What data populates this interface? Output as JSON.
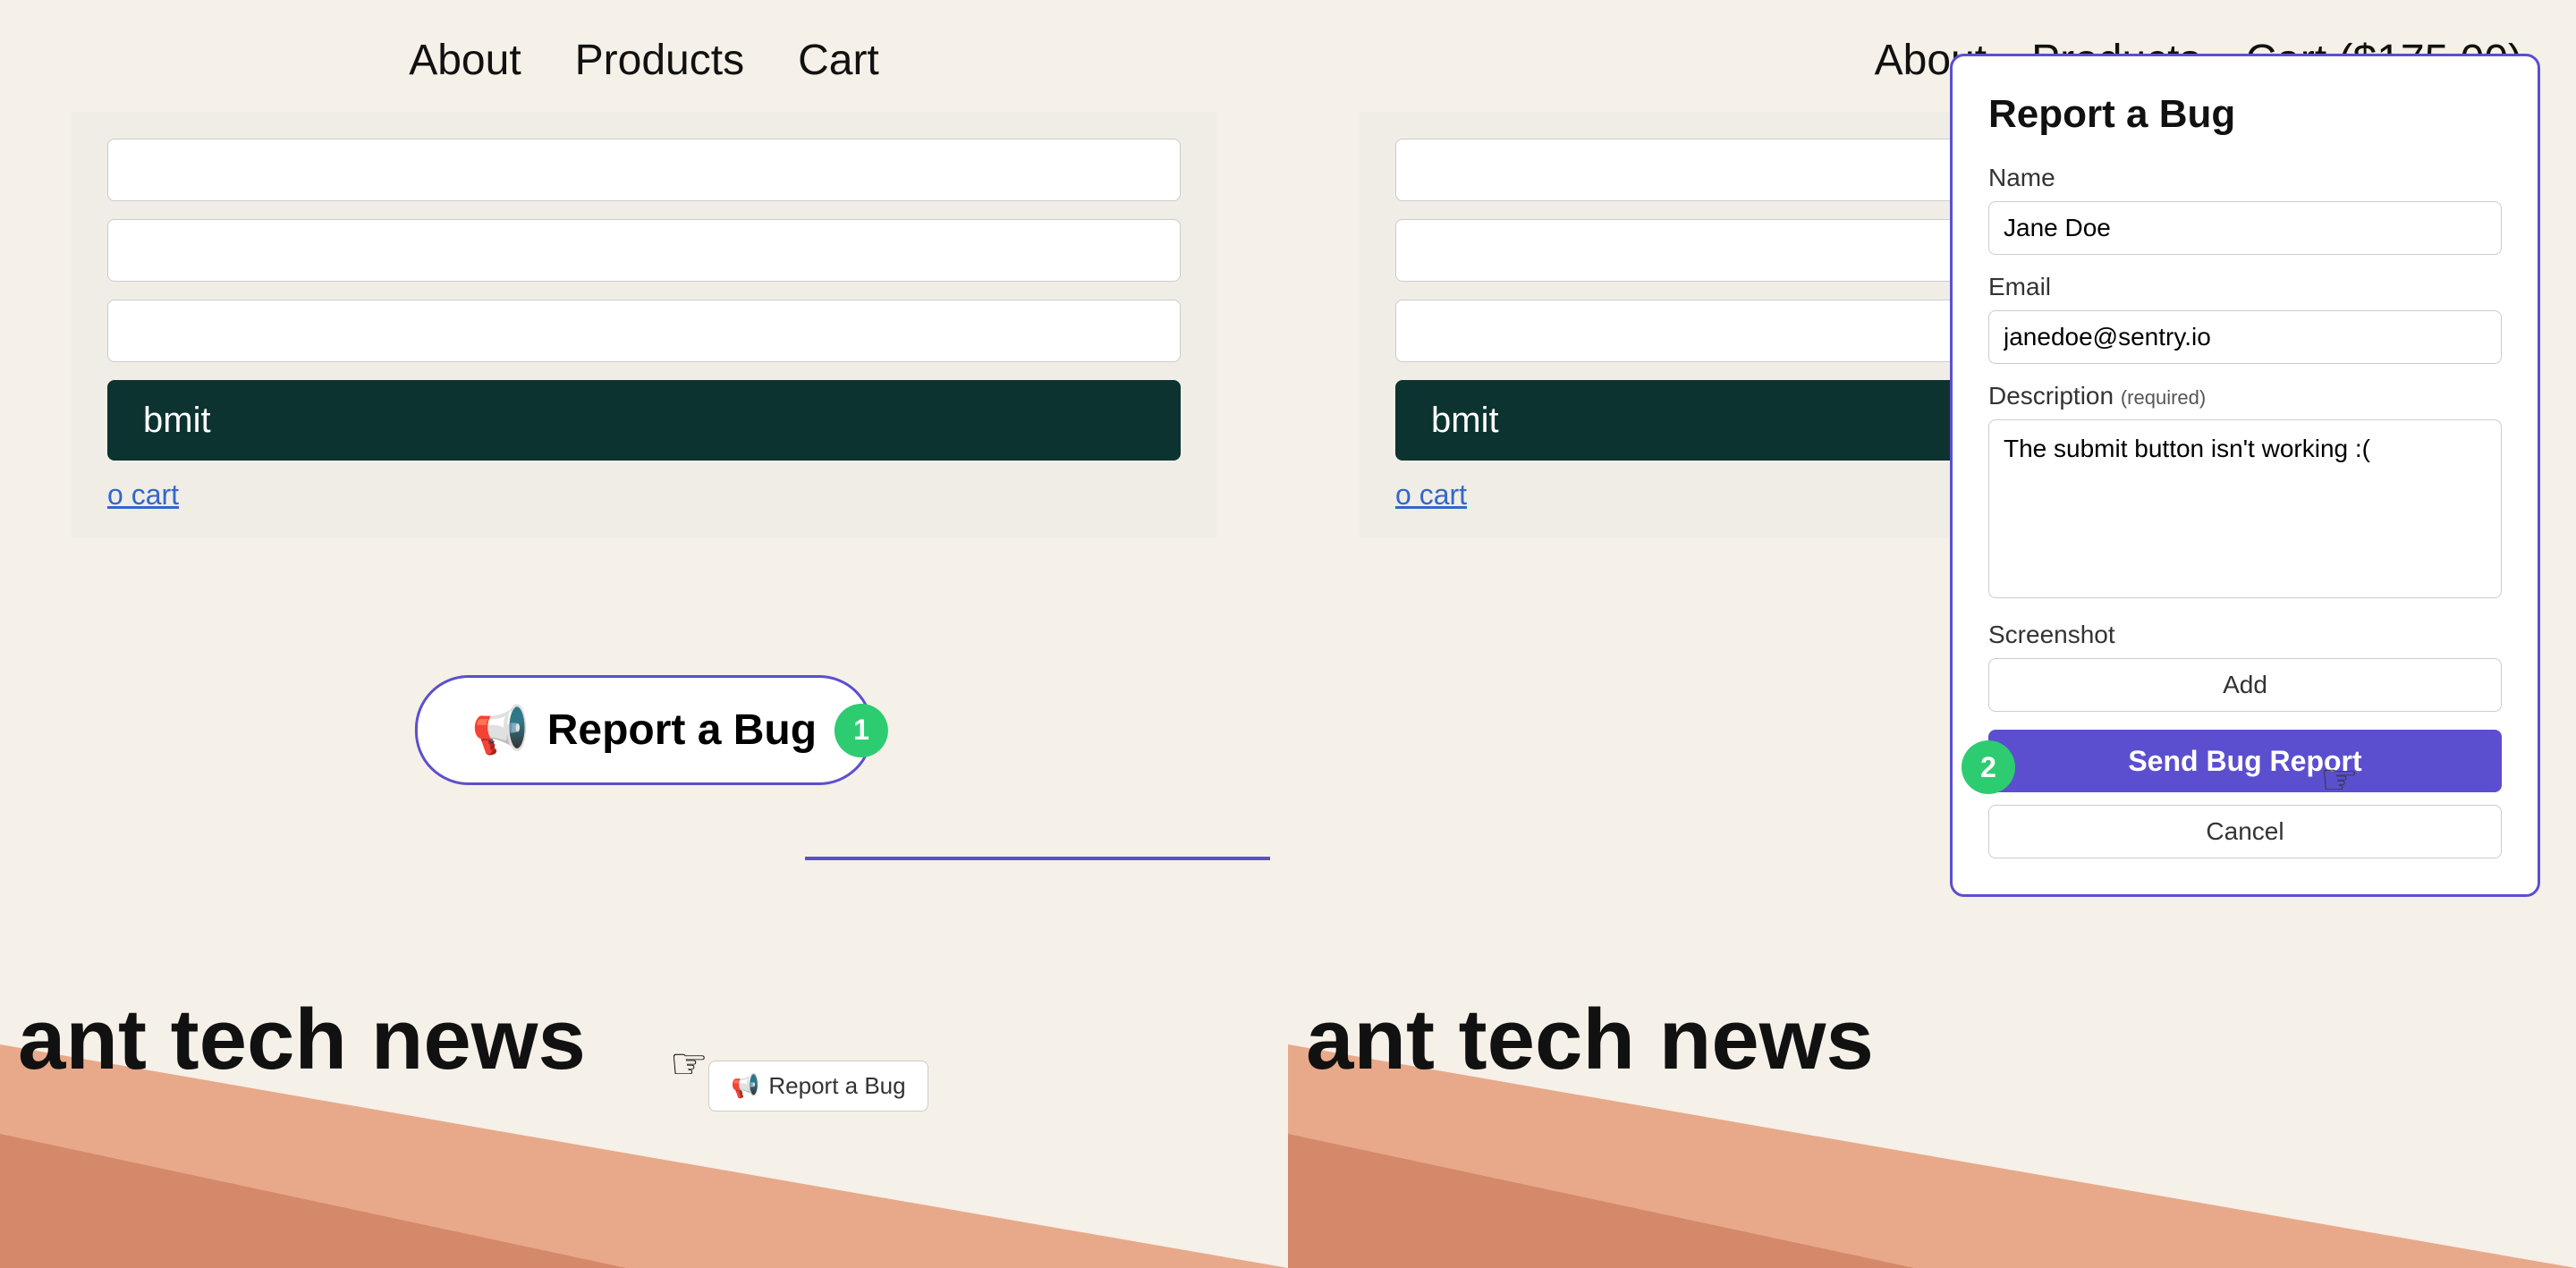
{
  "left": {
    "nav": {
      "about": "About",
      "products": "Products",
      "cart": "Cart"
    },
    "form": {
      "submit_btn": "bmit",
      "go_cart": "o cart"
    },
    "report_btn": "Report a Bug",
    "big_text": "ant tech news",
    "step1": "1"
  },
  "right": {
    "nav": {
      "about": "About",
      "products": "Products",
      "cart": "Cart ($175.00)"
    },
    "form": {
      "submit_btn": "bmit",
      "go_cart": "o cart"
    },
    "report_bug": {
      "title": "Report a Bug",
      "name_label": "Name",
      "name_value": "Jane Doe",
      "email_label": "Email",
      "email_value": "janedoe@sentry.io",
      "description_label": "Description",
      "description_required": "(required)",
      "description_value": "The submit button isn't working :(",
      "screenshot_label": "Screenshot",
      "add_btn": "Add",
      "send_btn": "Send Bug Report",
      "cancel_btn": "Cancel"
    },
    "step2": "2",
    "big_text": "ant tech news"
  }
}
